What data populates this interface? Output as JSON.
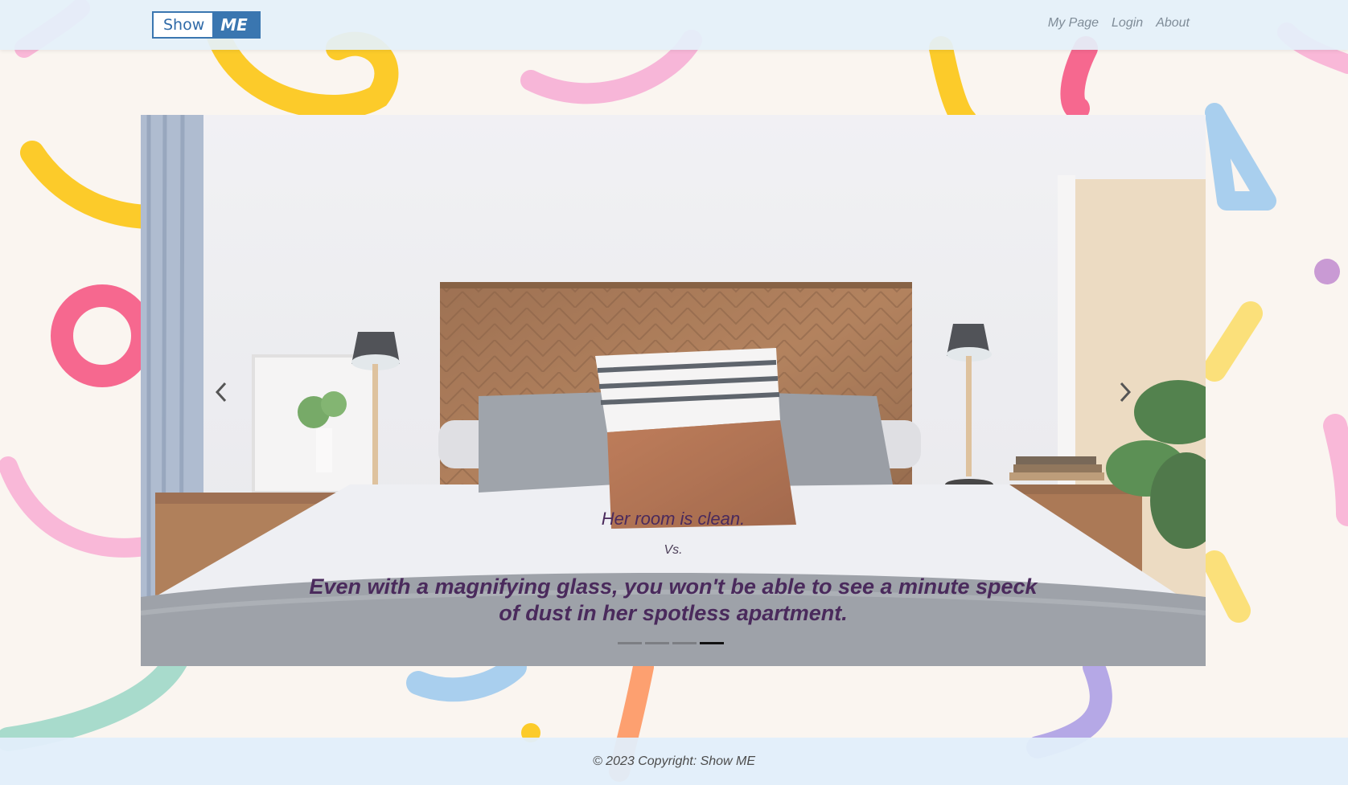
{
  "brand": {
    "part1": "Show",
    "part2": "ME"
  },
  "nav": {
    "items": [
      "My Page",
      "Login",
      "About"
    ]
  },
  "carousel": {
    "title": "Her room is clean.",
    "vs": "Vs.",
    "text": "Even with a magnifying glass, you won't be able to see a minute speck of dust in her spotless apartment.",
    "indicator_count": 4,
    "active_index": 3,
    "prev_icon": "chevron-left-icon",
    "next_icon": "chevron-right-icon"
  },
  "footer": {
    "text": "© 2023 Copyright: Show ME"
  },
  "colors": {
    "brand": "#3a76b0",
    "caption": "#4a2a5c",
    "navbar": "#e4f0fa"
  }
}
